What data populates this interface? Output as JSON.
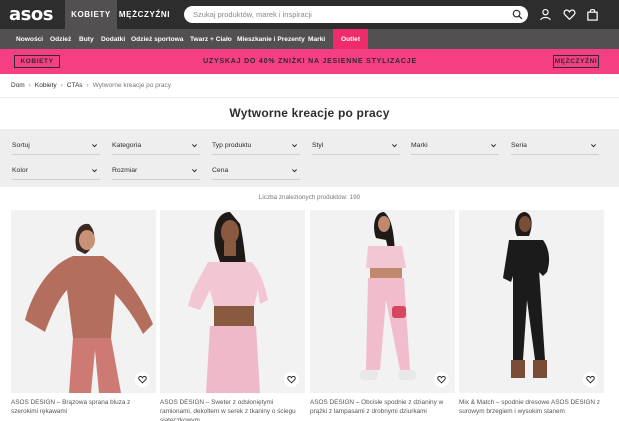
{
  "header": {
    "logo": "asos",
    "tabs": [
      "KOBIETY",
      "MĘŻCZYŹNI"
    ],
    "search_placeholder": "Szukaj produktów, marek i inspiracji"
  },
  "nav": {
    "items": [
      "Nowości",
      "Odzież",
      "Buty",
      "Dodatki",
      "Odzież sportowa",
      "Twarz + Ciało",
      "Mieszkanie i Prezenty",
      "Marki",
      "Outlet"
    ],
    "outlet_color": "#ee2c6c"
  },
  "promo": {
    "left_button": "KOBIETY",
    "text": "UZYSKAJ DO 40% ZNIŻKI NA JESIENNE STYLIZACJE",
    "right_button": "MĘŻCZYŹNI",
    "background": "#f63e82"
  },
  "breadcrumb": [
    "Dom",
    "Kobiety",
    "CTAs",
    "Wytworne kreacje po pracy"
  ],
  "page_title": "Wytworne kreacje po pracy",
  "filters": [
    "Sortuj",
    "Kategoria",
    "Typ produktu",
    "Styl",
    "Marki",
    "Seria",
    "Kolor",
    "Rozmiar",
    "Cena"
  ],
  "result_count": "Liczba znalezionych produktów: 190",
  "products": [
    {
      "description": "ASOS DESIGN – Brązowa sprana bluza z szerokimi rękawami"
    },
    {
      "description": "ASOS DESIGN – Sweter z odsłoniętymi ramionami, dekoltem w serek z tkaniny o ściegu siateczkowym"
    },
    {
      "description": "ASOS DESIGN – Obcisłe spodnie z dzianiny w prążki z lampasami z drobnymi dziurkami"
    },
    {
      "description": "Mix & Match – spodnie dresowe ASOS DESIGN z surowym brzegiem i wysokim stanem"
    }
  ]
}
